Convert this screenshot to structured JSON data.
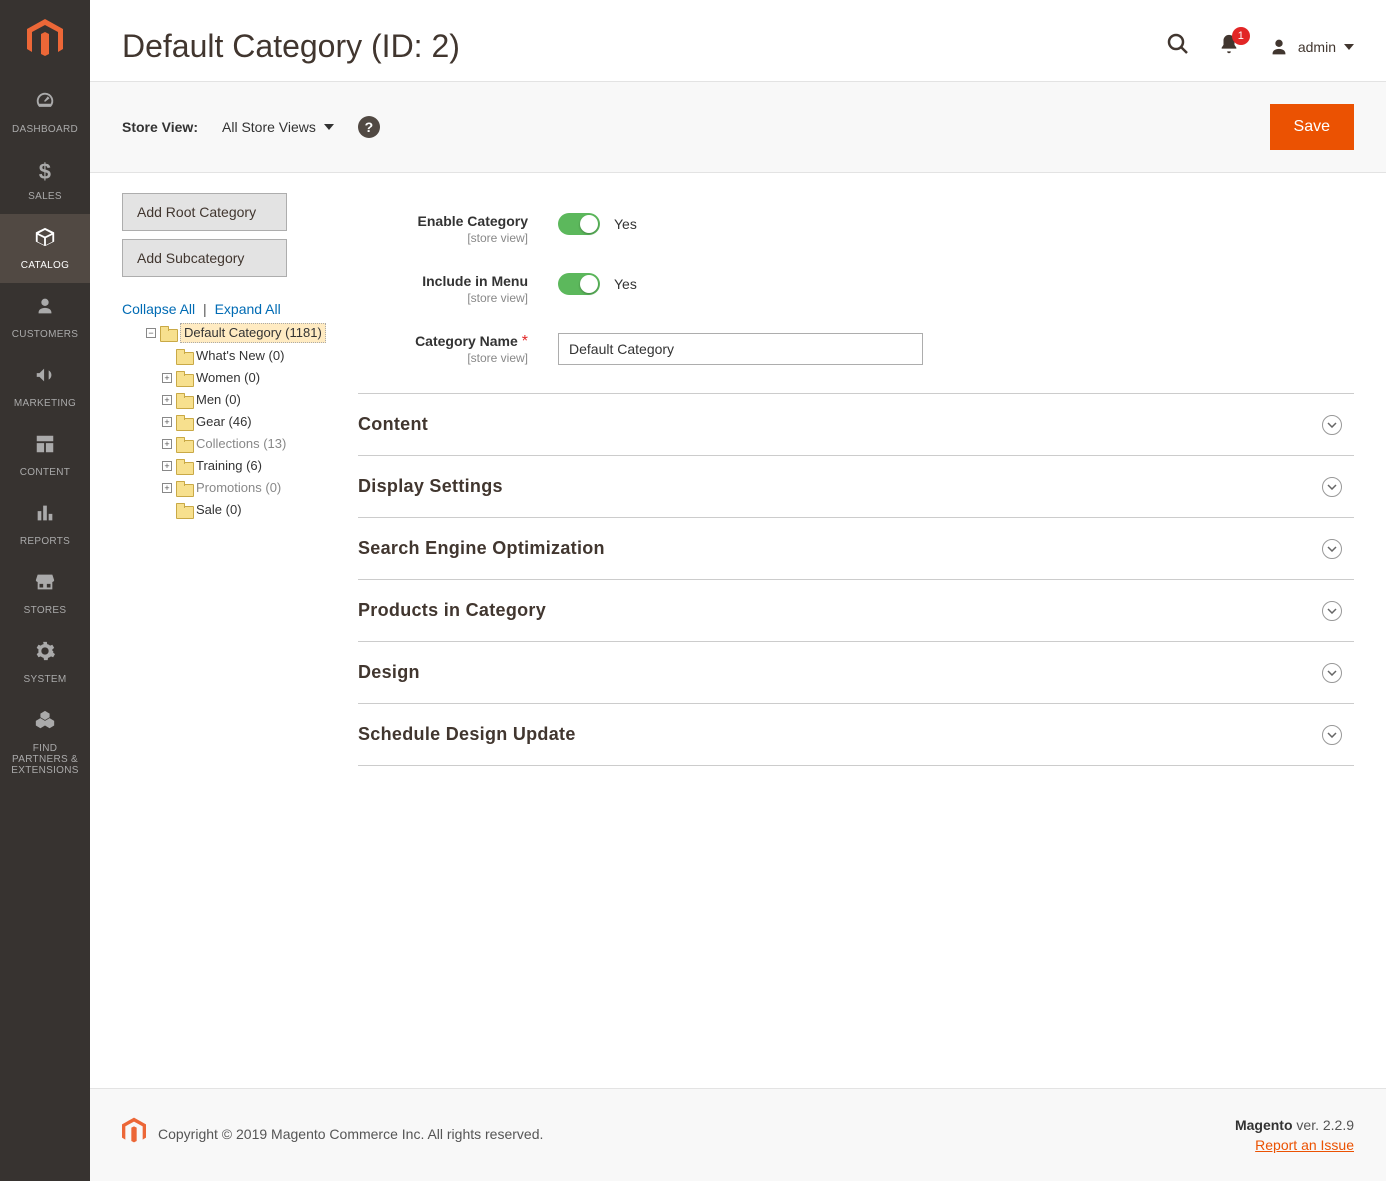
{
  "sidebar": {
    "items": [
      {
        "label": "DASHBOARD"
      },
      {
        "label": "SALES"
      },
      {
        "label": "CATALOG"
      },
      {
        "label": "CUSTOMERS"
      },
      {
        "label": "MARKETING"
      },
      {
        "label": "CONTENT"
      },
      {
        "label": "REPORTS"
      },
      {
        "label": "STORES"
      },
      {
        "label": "SYSTEM"
      },
      {
        "label": "FIND PARTNERS & EXTENSIONS"
      }
    ]
  },
  "header": {
    "page_title": "Default Category (ID: 2)",
    "notification_count": "1",
    "admin_user": "admin"
  },
  "toolbar": {
    "store_view_label": "Store View:",
    "store_view_value": "All Store Views",
    "save_label": "Save"
  },
  "tree_panel": {
    "add_root_label": "Add Root Category",
    "add_sub_label": "Add Subcategory",
    "collapse_label": "Collapse All",
    "expand_label": "Expand All",
    "nodes": {
      "root": "Default Category (1181)",
      "whats_new": "What's New (0)",
      "women": "Women (0)",
      "men": "Men (0)",
      "gear": "Gear (46)",
      "collections": "Collections (13)",
      "training": "Training (6)",
      "promotions": "Promotions (0)",
      "sale": "Sale (0)"
    }
  },
  "form": {
    "enable_category": {
      "label": "Enable Category",
      "scope": "[store view]",
      "value": "Yes"
    },
    "include_in_menu": {
      "label": "Include in Menu",
      "scope": "[store view]",
      "value": "Yes"
    },
    "category_name": {
      "label": "Category Name",
      "scope": "[store view]",
      "value": "Default Category"
    }
  },
  "accordion": {
    "content": "Content",
    "display_settings": "Display Settings",
    "seo": "Search Engine Optimization",
    "products": "Products in Category",
    "design": "Design",
    "schedule": "Schedule Design Update"
  },
  "footer": {
    "copyright": "Copyright © 2019 Magento Commerce Inc. All rights reserved.",
    "magento": "Magento",
    "version": " ver. 2.2.9",
    "report_link": "Report an Issue"
  }
}
